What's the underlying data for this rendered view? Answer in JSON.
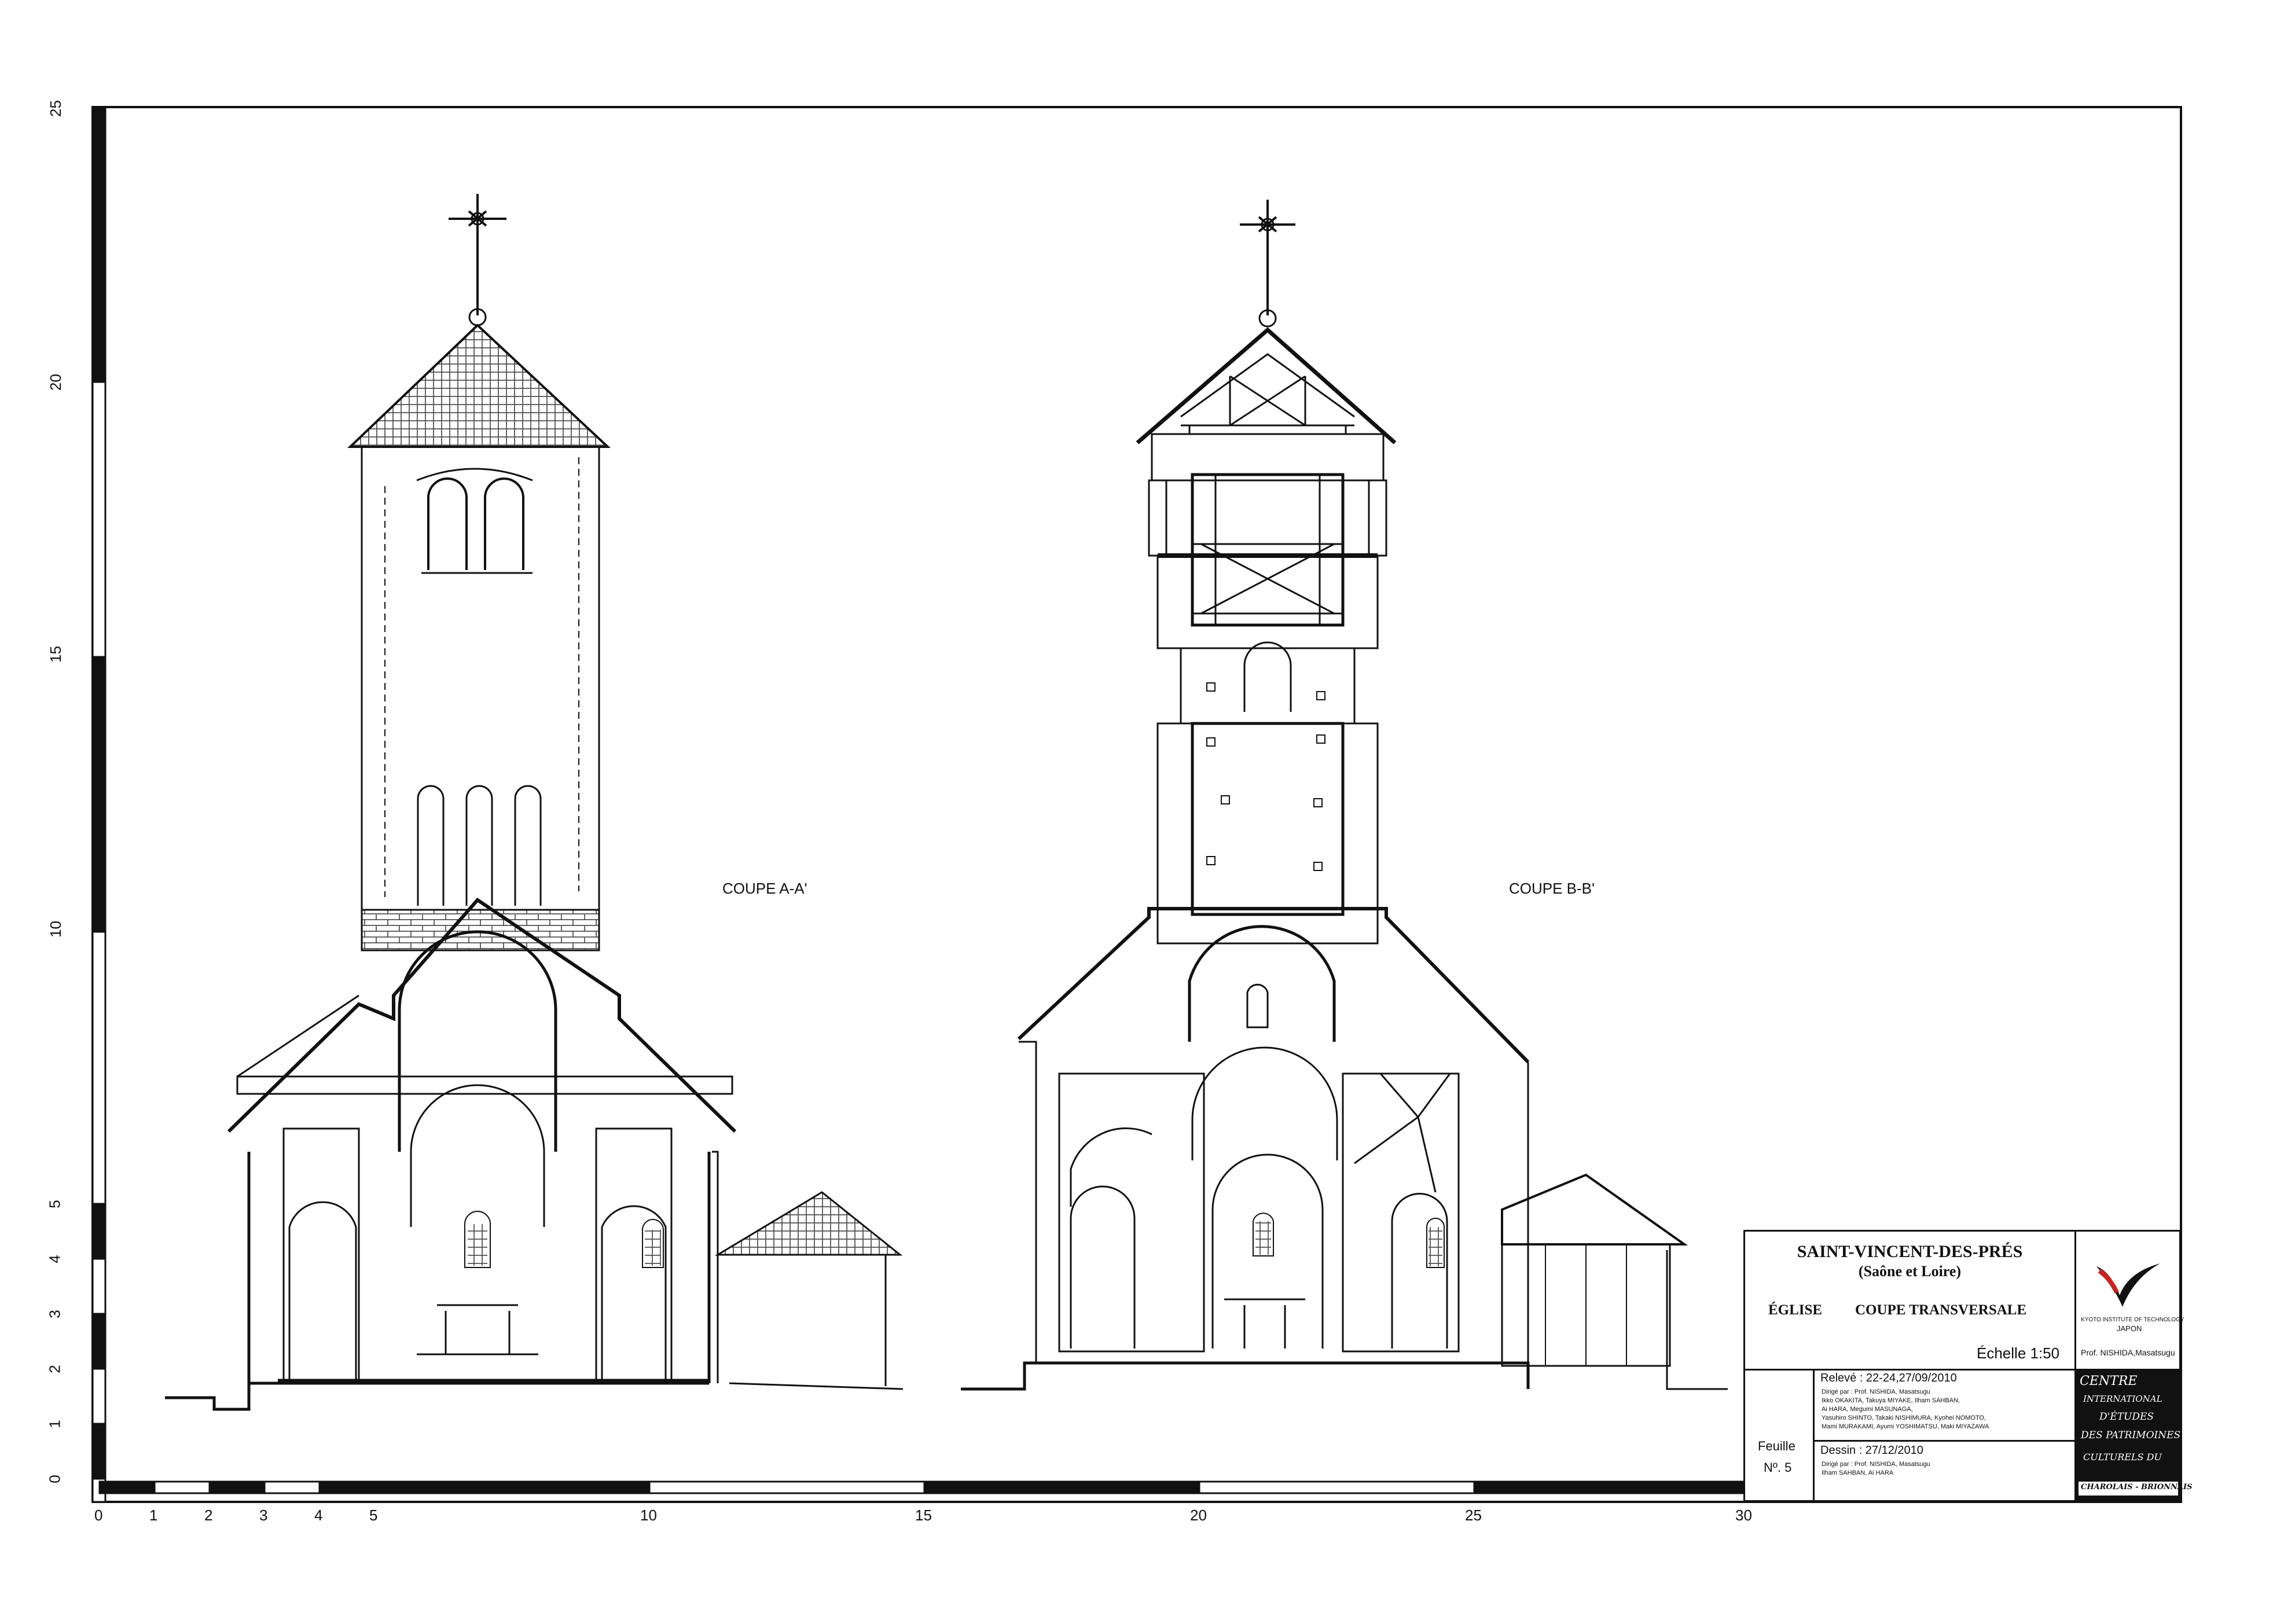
{
  "section_labels": {
    "a": "COUPE A-A'",
    "b": "COUPE B-B'"
  },
  "axis": {
    "x_ticks": [
      "0",
      "1",
      "2",
      "3",
      "4",
      "5",
      "10",
      "15",
      "20",
      "25",
      "30"
    ],
    "y_ticks": [
      "0",
      "1",
      "2",
      "3",
      "4",
      "5",
      "10",
      "15",
      "20",
      "25"
    ]
  },
  "cartouche": {
    "site": "SAINT-VINCENT-DES-PRÉS",
    "region": "(Saône et Loire)",
    "building": "ÉGLISE",
    "drawing": "COUPE TRANSVERSALE",
    "scale": "Échelle  1:50",
    "institute": "KYOTO INSTITUTE OF TECHNOLOGY",
    "country": "JAPON",
    "professor": "Prof. NISHIDA,Masatsugu",
    "releve_label": "Relevé  :  22-24,27/09/2010",
    "releve_dirige": "Dirigé par : Prof. NISHIDA, Masatsugu",
    "releve_team": [
      "Ikko OKAKITA,  Takuya MIYAKE,  Ilham SAHBAN,",
      "Ai HARA,  Megumi MASUNAGA,",
      "Yasuhiro SHINTO,  Takaki NISHIMURA,  Kyohei NOMOTO,",
      "Mami MURAKAMI,  Ayumi YOSHIMATSU,  Maki MIYAZAWA"
    ],
    "dessin_label": "Dessin  :  27/12/2010",
    "dessin_dirige": "Dirigé par : Prof. NISHIDA, Masatsugu",
    "dessin_team": "Ilham SAHBAN, Ai HARA",
    "feuille": "Feuille",
    "numero": "Nº. 5",
    "centre_lines": [
      "CENTRE",
      "INTERNATIONAL",
      "D'ÉTUDES",
      "DES PATRIMOINES",
      "CULTURELS DU",
      "CHAROLAIS - BRIONNAIS"
    ]
  },
  "colors": {
    "ink": "#111111",
    "paper": "#ffffff",
    "roof_hatch": "#555555"
  }
}
